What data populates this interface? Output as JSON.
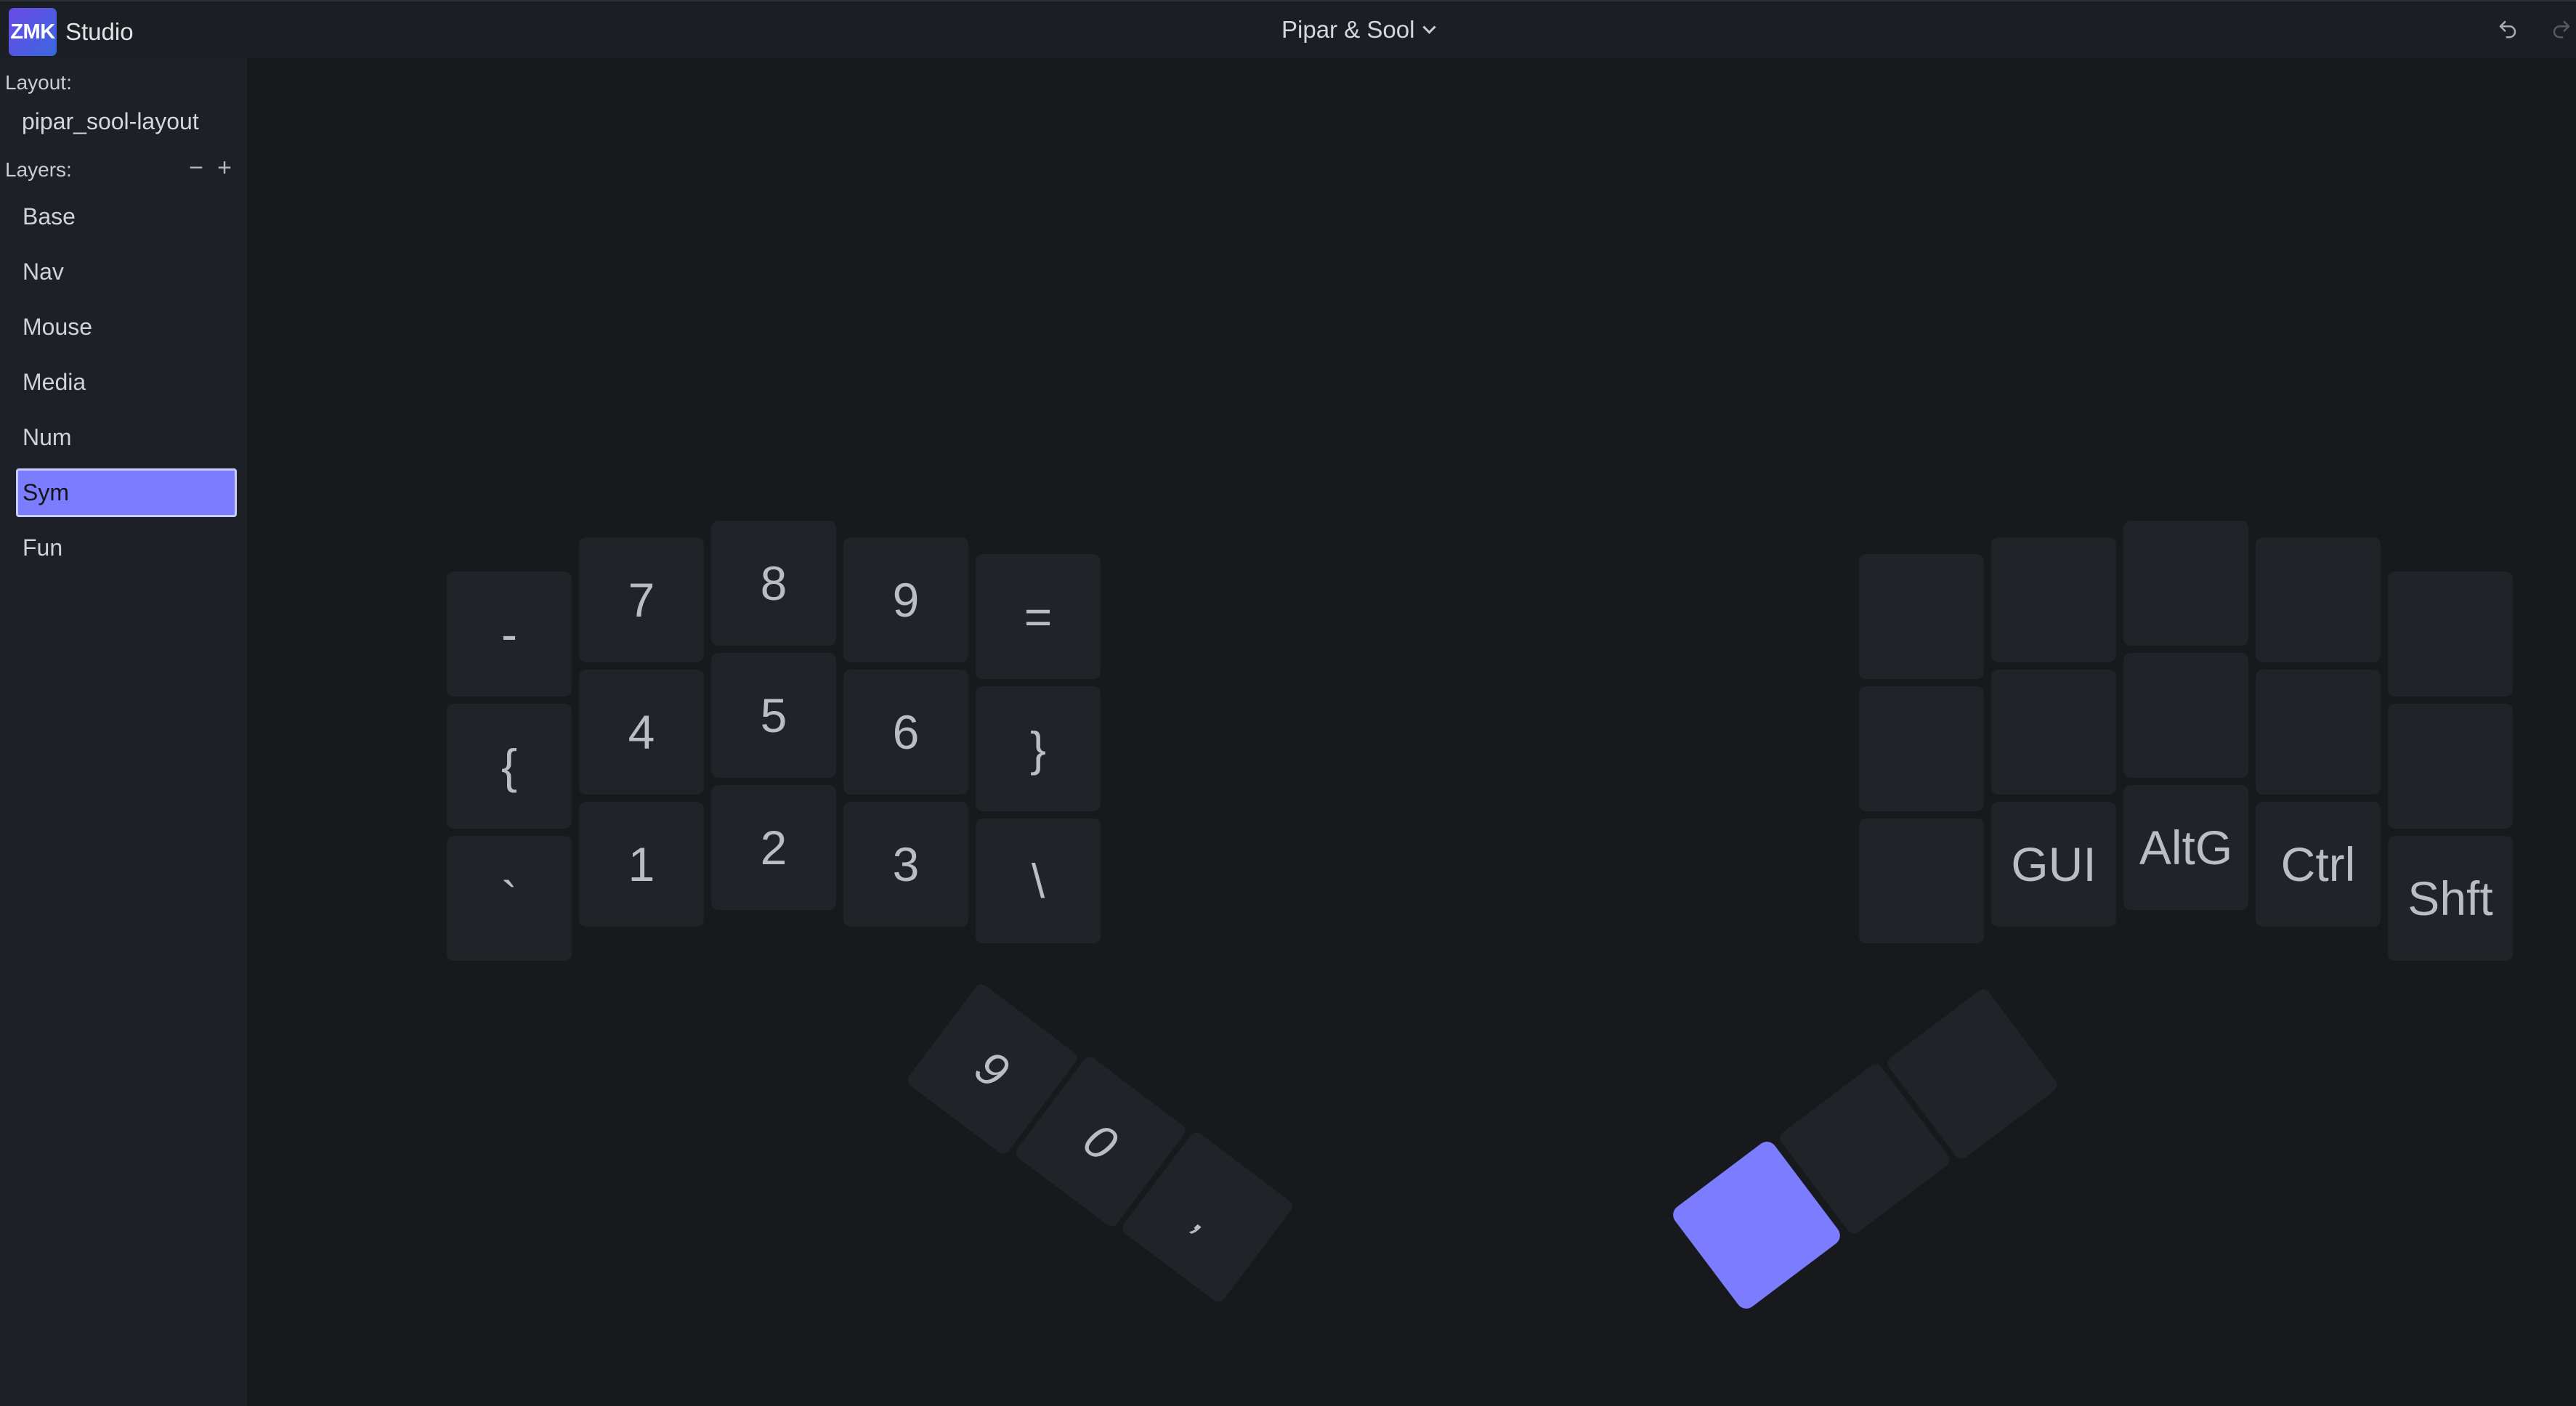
{
  "app": {
    "logo_text": "ZMK",
    "name": "Studio"
  },
  "header": {
    "keyboard_name": "Pipar & Sool",
    "undo_icon": "undo-icon",
    "redo_icon": "redo-icon"
  },
  "sidebar": {
    "layout_label": "Layout:",
    "layout_value": "pipar_sool-layout",
    "layers_label": "Layers:",
    "remove_symbol": "−",
    "add_symbol": "+",
    "layers": [
      {
        "label": "Base",
        "active": false
      },
      {
        "label": "Nav",
        "active": false
      },
      {
        "label": "Mouse",
        "active": false
      },
      {
        "label": "Media",
        "active": false
      },
      {
        "label": "Num",
        "active": false
      },
      {
        "label": "Sym",
        "active": true
      },
      {
        "label": "Fun",
        "active": false
      }
    ]
  },
  "keymap": {
    "left_rows": [
      [
        "-",
        "7",
        "8",
        "9",
        "="
      ],
      [
        "{",
        "4",
        "5",
        "6",
        "}"
      ],
      [
        "`",
        "1",
        "2",
        "3",
        "\\"
      ]
    ],
    "left_thumbs": [
      "9",
      "0",
      ","
    ],
    "right_rows": [
      [
        "",
        "",
        "",
        "",
        ""
      ],
      [
        "",
        "",
        "",
        "",
        ""
      ],
      [
        "",
        "GUI",
        "AltG",
        "Ctrl",
        "Shft"
      ]
    ],
    "right_thumbs": [
      "",
      "",
      ""
    ],
    "selected_key": "right-thumb-inner",
    "accent_color": "#7c7cff"
  }
}
